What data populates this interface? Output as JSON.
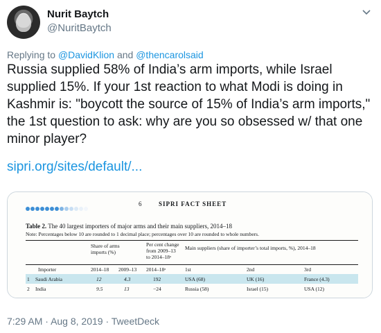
{
  "author": {
    "name": "Nurit Baytch",
    "handle": "@NuritBaytch",
    "avatar_icon": "avatar-portrait"
  },
  "menu_icon": "chevron-down-icon",
  "reply": {
    "prefix": "Replying to",
    "user1": "@DavidKlion",
    "and": "and",
    "user2": "@thencarolsaid"
  },
  "tweet": {
    "text": "Russia supplied 58% of India’s arm imports, while Israel supplied 15%. If your 1st reaction to what Modi is doing in Kashmir is: \"boycott the source of 15% of India’s arm imports,\" the 1st question to ask: why are you so obsessed w/ that one minor player?",
    "link": "sipri.org/sites/default/..."
  },
  "media": {
    "page_number": "6",
    "page_header": "SIPRI FACT SHEET",
    "table_title_bold": "Table 2.",
    "table_title_rest": " The 40 largest importers of major arms and their main suppliers, 2014–18",
    "note_label": "Note:",
    "note_text": " Percentages below 10 are rounded to 1 decimal place; percentages over 10 are rounded to whole numbers.",
    "columns": {
      "share": "Share of arms imports (%)",
      "change": "Per cent change from 2009–13 to 2014–18ᵃ",
      "suppliers": "Main suppliers (share of importer’s total imports, %), 2014–18",
      "importer": "Importer",
      "y1418": "2014–18",
      "y0913": "2009–13",
      "y1418b": "2014–18ᵃ",
      "first": "1st",
      "second": "2nd",
      "third": "3rd"
    },
    "rows": [
      {
        "rank": "1",
        "importer": "Saudi Arabia",
        "share1418": "12",
        "share0913": "4.3",
        "change": "192",
        "s1": "USA (68)",
        "s2": "UK (16)",
        "s3": "France (4.3)"
      },
      {
        "rank": "2",
        "importer": "India",
        "share1418": "9.5",
        "share0913": "13",
        "change": "−24",
        "s1": "Russia (58)",
        "s2": "Israel (15)",
        "s3": "USA (12)"
      }
    ],
    "colors": {
      "dots": "#3d8fd6",
      "band": "#c9e6ee"
    }
  },
  "footer": {
    "time": "7:29 AM",
    "sep1": "·",
    "date": "Aug 8, 2019",
    "sep2": "·",
    "source": "TweetDeck"
  }
}
